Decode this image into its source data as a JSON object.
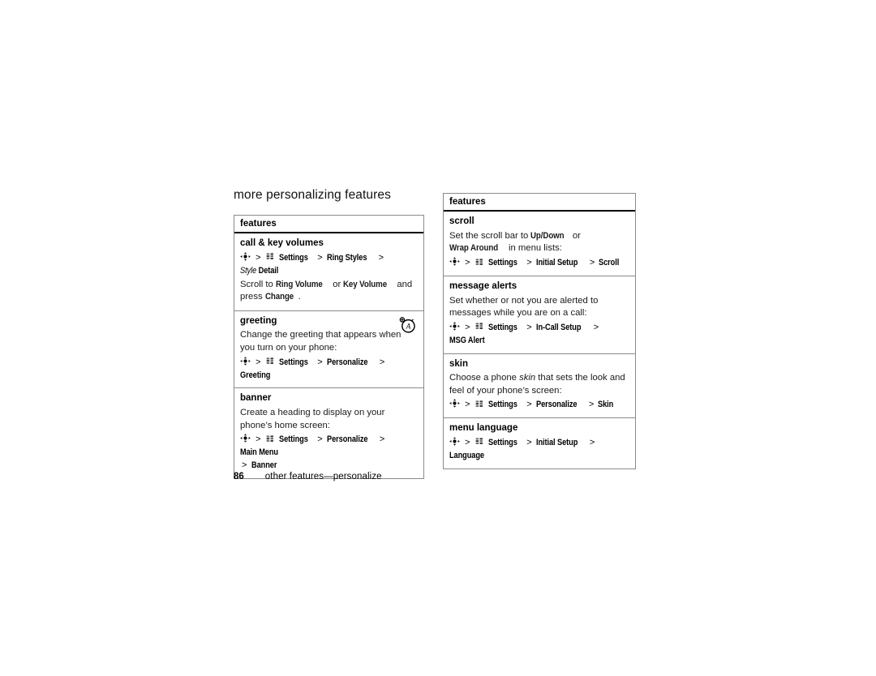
{
  "page": {
    "section_title": "more personalizing features",
    "footer_page_number": "86",
    "footer_text": "other features—personalize"
  },
  "icons": {
    "nav_key": "navigation-key-icon",
    "settings_menu": "settings-menu-icon",
    "text_entry": "text-entry-icon"
  },
  "tables": {
    "left": {
      "header": "features",
      "rows": [
        {
          "name": "call & key volumes",
          "description": null,
          "paths": [
            {
              "parts": [
                "nav",
                "Settings",
                "Ring Styles",
                "Style Detail"
              ]
            }
          ],
          "extra": "Scroll to Ring Volume or Key Volume and press Change.",
          "extra_parts": [
            {
              "t": "Scroll to ",
              "s": "plain"
            },
            {
              "t": "Ring Volume",
              "s": "cond"
            },
            {
              "t": " or ",
              "s": "plain"
            },
            {
              "t": "Key Volume",
              "s": "cond"
            },
            {
              "t": " and press ",
              "s": "plain"
            },
            {
              "t": "Change",
              "s": "cond"
            },
            {
              "t": ".",
              "s": "plain"
            }
          ],
          "badge": "text-entry-icon"
        },
        {
          "name": "greeting",
          "description": "Change the greeting that appears when you turn on your phone:",
          "paths": [
            {
              "parts": [
                "nav",
                "Settings",
                "Personalize",
                "Greeting"
              ]
            }
          ]
        },
        {
          "name": "banner",
          "description": "Create a heading to display on your phone’s home screen:",
          "paths": [
            {
              "parts": [
                "nav",
                "Settings",
                "Personalize",
                "Main Menu",
                "Banner"
              ]
            }
          ]
        }
      ]
    },
    "right": {
      "header": "features",
      "rows": [
        {
          "name": "scroll",
          "description": "Set the scroll bar to Up/Down or Wrap Around in menu lists:",
          "description_parts": [
            {
              "t": "Set the scroll bar to ",
              "s": "plain"
            },
            {
              "t": "Up/Down",
              "s": "cond"
            },
            {
              "t": " or ",
              "s": "plain"
            },
            {
              "t": "Wrap Around",
              "s": "cond"
            },
            {
              "t": " in menu lists:",
              "s": "plain"
            }
          ],
          "paths": [
            {
              "parts": [
                "nav",
                "Settings",
                "Initial Setup",
                "Scroll"
              ]
            }
          ]
        },
        {
          "name": "message alerts",
          "description": "Set whether or not you are alerted to messages while you are on a call:",
          "paths": [
            {
              "parts": [
                "nav",
                "Settings",
                "In-Call Setup",
                "MSG Alert"
              ]
            }
          ]
        },
        {
          "name": "skin",
          "description": "Choose a phone skin that sets the look and feel of your phone’s screen:",
          "description_parts": [
            {
              "t": "Choose a phone ",
              "s": "plain"
            },
            {
              "t": "skin",
              "s": "ital"
            },
            {
              "t": " that sets the look and feel of your phone’s screen:",
              "s": "plain"
            }
          ],
          "paths": [
            {
              "parts": [
                "nav",
                "Settings",
                "Personalize",
                "Skin"
              ]
            }
          ]
        },
        {
          "name": "menu language",
          "description": null,
          "paths": [
            {
              "parts": [
                "nav",
                "Settings",
                "Initial Setup",
                "Language"
              ]
            }
          ]
        }
      ]
    }
  },
  "colors": {
    "text": "#000000",
    "border": "#8a8a8a",
    "rule": "#000000",
    "background": "#ffffff"
  }
}
